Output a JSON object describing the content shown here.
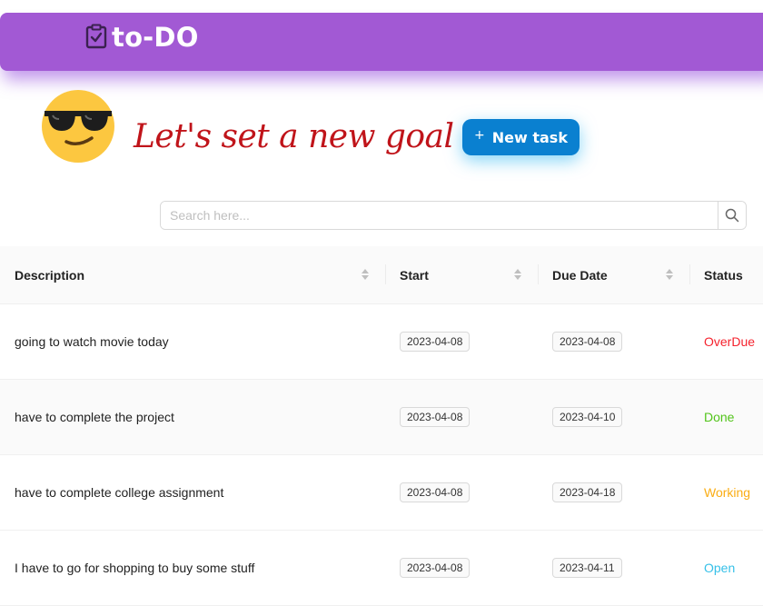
{
  "app": {
    "title": "to-DO",
    "accent": "#a259d4"
  },
  "hero": {
    "emoji_icon": "smiling-face-with-sunglasses-icon",
    "headline": "Let's set a new goal",
    "new_task_plus": "+",
    "new_task_label": "New task",
    "button_color": "#0a80d0"
  },
  "search": {
    "placeholder": "Search here...",
    "value": ""
  },
  "table": {
    "columns": [
      "Description",
      "Start",
      "Due Date",
      "Status"
    ],
    "rows": [
      {
        "description": "going to watch movie today",
        "start": "2023-04-08",
        "due": "2023-04-08",
        "status": "OverDue",
        "status_color": "#f5222d"
      },
      {
        "description": "have to complete the project",
        "start": "2023-04-08",
        "due": "2023-04-10",
        "status": "Done",
        "status_color": "#52c41a"
      },
      {
        "description": "have to complete college assignment",
        "start": "2023-04-08",
        "due": "2023-04-18",
        "status": "Working",
        "status_color": "#faad14"
      },
      {
        "description": "I have to go for shopping to buy some stuff",
        "start": "2023-04-08",
        "due": "2023-04-11",
        "status": "Open",
        "status_color": "#36c0e8"
      }
    ]
  }
}
